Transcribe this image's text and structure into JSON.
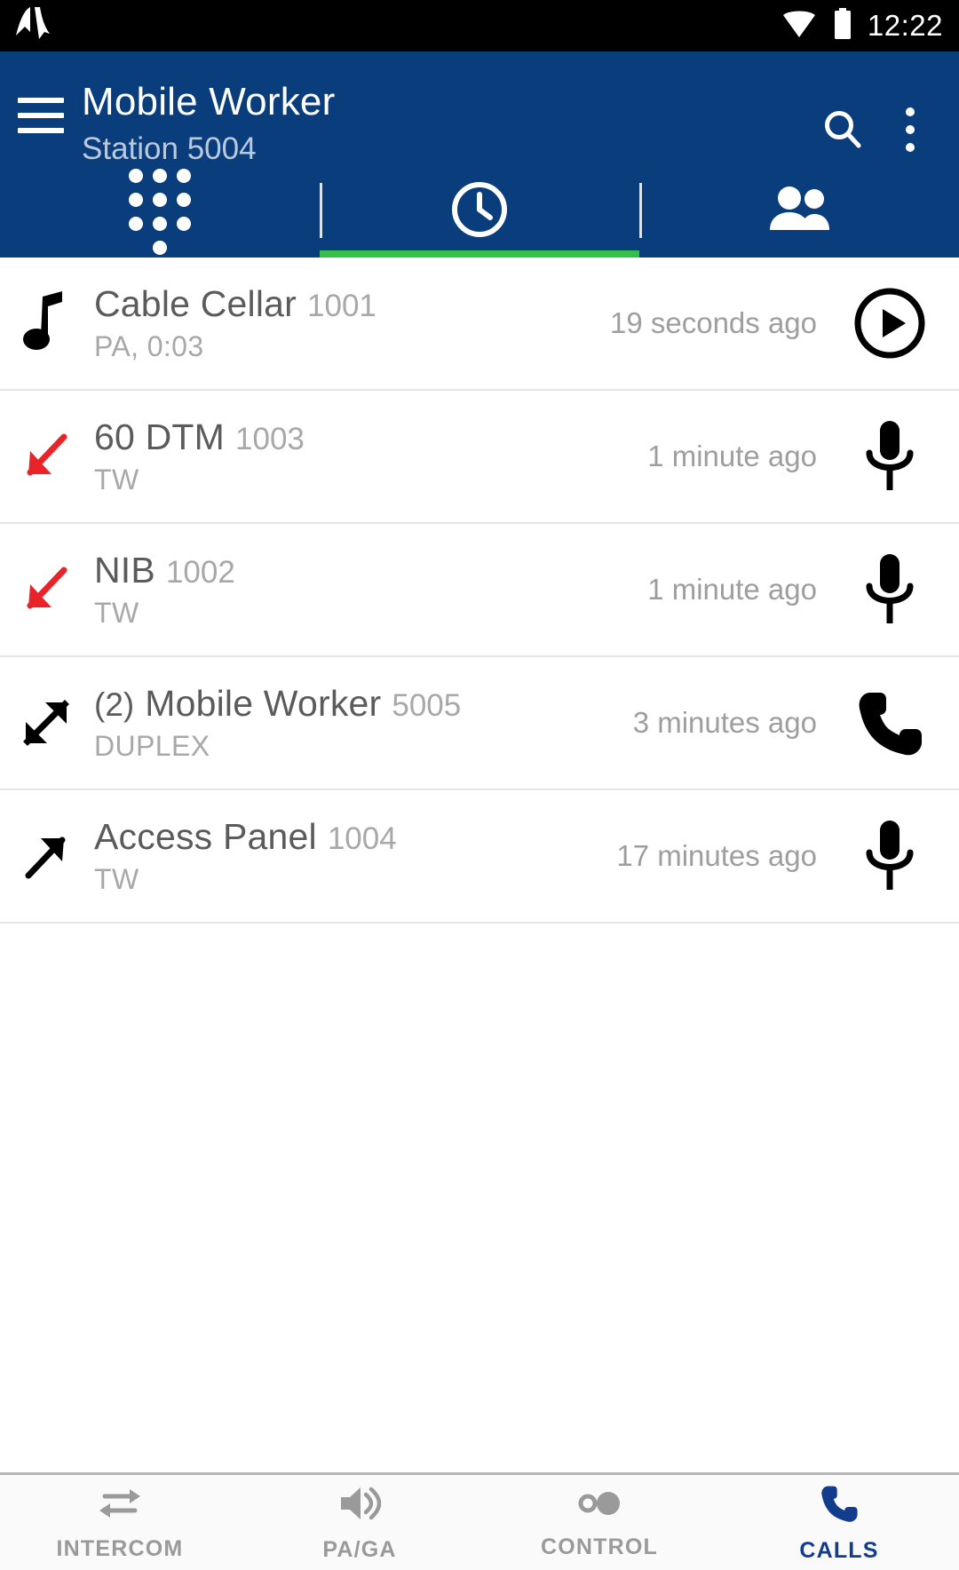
{
  "status_bar": {
    "notification_icon": "av-waveform-icon",
    "wifi_icon": "wifi-icon",
    "battery_icon": "battery-full-icon",
    "time": "12:22"
  },
  "app_bar": {
    "menu_icon": "hamburger-menu-icon",
    "title": "Mobile Worker",
    "subtitle": "Station 5004",
    "search_icon": "search-icon",
    "overflow_icon": "more-vert-icon",
    "brand_color": "#0a3d7c",
    "accent_color": "#35c04a"
  },
  "tabs": [
    {
      "name": "dialpad",
      "icon": "dialpad-icon",
      "active": false
    },
    {
      "name": "recents",
      "icon": "clock-icon",
      "active": true
    },
    {
      "name": "contacts",
      "icon": "people-icon",
      "active": false
    }
  ],
  "calls": [
    {
      "direction_icon": "music-note-icon",
      "direction_color": "#000000",
      "prefix": "",
      "name": "Cable Cellar",
      "extension": "1001",
      "subtitle": "PA, 0:03",
      "time": "19 seconds ago",
      "action_icon": "play-circle-icon"
    },
    {
      "direction_icon": "arrow-incoming-missed-icon",
      "direction_color": "#e8242a",
      "prefix": "",
      "name": "60 DTM",
      "extension": "1003",
      "subtitle": "TW",
      "time": "1 minute ago",
      "action_icon": "microphone-icon"
    },
    {
      "direction_icon": "arrow-incoming-missed-icon",
      "direction_color": "#e8242a",
      "prefix": "",
      "name": "NIB",
      "extension": "1002",
      "subtitle": "TW",
      "time": "1 minute ago",
      "action_icon": "microphone-icon"
    },
    {
      "direction_icon": "arrow-duplex-icon",
      "direction_color": "#000000",
      "prefix": "(2)",
      "name": "Mobile Worker",
      "extension": "5005",
      "subtitle": "DUPLEX",
      "time": "3 minutes ago",
      "action_icon": "phone-icon"
    },
    {
      "direction_icon": "arrow-outgoing-icon",
      "direction_color": "#000000",
      "prefix": "",
      "name": "Access Panel",
      "extension": "1004",
      "subtitle": "TW",
      "time": "17 minutes ago",
      "action_icon": "microphone-icon"
    }
  ],
  "bottom_nav": [
    {
      "label": "INTERCOM",
      "icon": "swap-arrows-icon",
      "active": false
    },
    {
      "label": "PA/GA",
      "icon": "speaker-icon",
      "active": false
    },
    {
      "label": "CONTROL",
      "icon": "toggle-dots-icon",
      "active": false
    },
    {
      "label": "CALLS",
      "icon": "phone-icon",
      "active": true
    }
  ]
}
